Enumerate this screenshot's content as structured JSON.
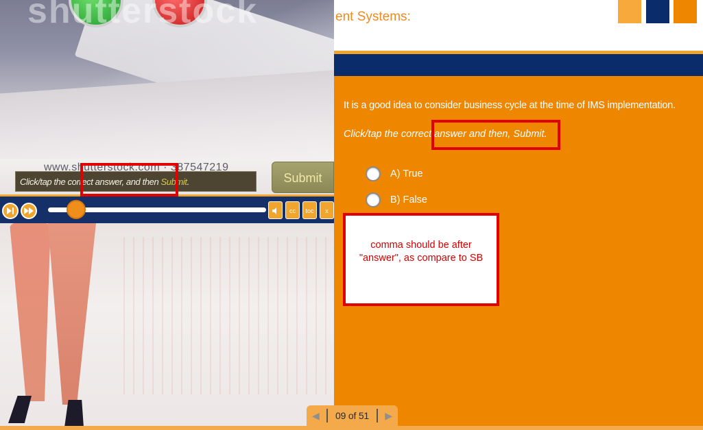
{
  "left_panel": {
    "watermark_top": "shutterstock",
    "watermark_url": "www.shutterstock.com · 387547219",
    "caption": {
      "before": "Click/tap the correct answer, and then ",
      "highlight": "Submit",
      "after": "."
    },
    "submit_label": "Submit",
    "player": {
      "play_icon": "play-next-icon",
      "forward_icon": "fast-forward-icon",
      "progress": 0.13,
      "buttons": [
        {
          "name": "volume-icon",
          "glyph": "🔈"
        },
        {
          "name": "cc-icon",
          "glyph": "cc"
        },
        {
          "name": "toc-icon",
          "glyph": "toc"
        },
        {
          "name": "close-icon",
          "glyph": "x"
        }
      ]
    }
  },
  "right_panel": {
    "header_title": "ent Systems:",
    "header_squares": [
      "#f7a93b",
      "#0a2c6b",
      "#ee8600"
    ],
    "question": "It is a good idea to consider business cycle at the time of IMS implementation.",
    "instruction": "Click/tap the correct answer and then, Submit.",
    "options": [
      {
        "letter": "A)",
        "label": "True"
      },
      {
        "letter": "B)",
        "label": "False"
      }
    ]
  },
  "annotation": {
    "text": "comma should be after \"answer\", as compare to SB"
  },
  "pager": {
    "label": "09 of 51"
  },
  "colors": {
    "orange": "#ee8600",
    "navy": "#0a2c6b",
    "annotation_red": "#e00000"
  }
}
